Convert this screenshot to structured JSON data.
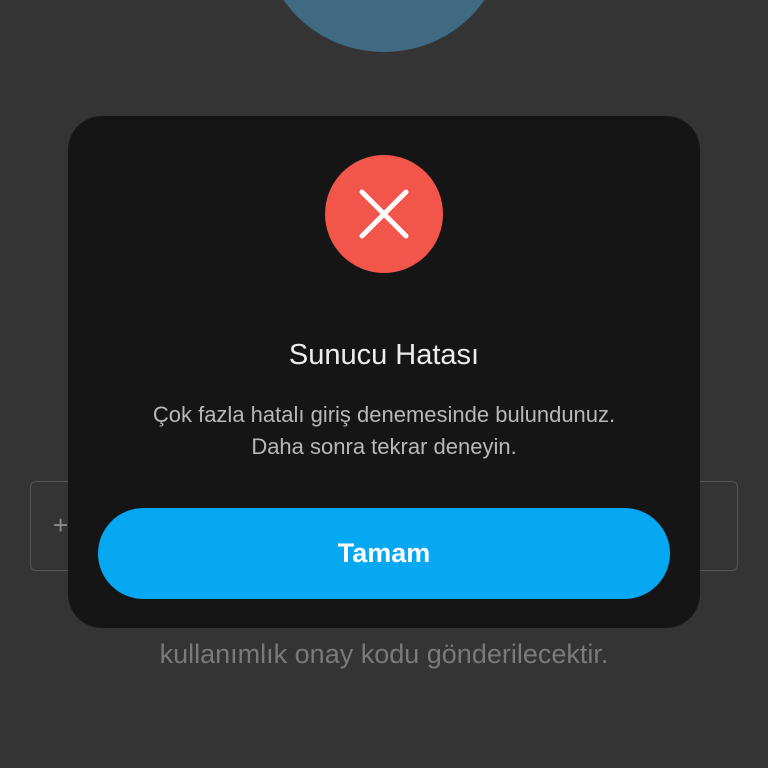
{
  "background": {
    "phone_prefix": "+",
    "info_line_1": "kullanımlık onay kodu gönderilecektir.",
    "info_line_2": ""
  },
  "dialog": {
    "icon": "error-x-icon",
    "title": "Sunucu Hatası",
    "message_line_1": "Çok fazla hatalı giriş denemesinde bulundunuz.",
    "message_line_2": "Daha sonra tekrar deneyin.",
    "ok_label": "Tamam"
  },
  "colors": {
    "backdrop": "#343434",
    "dialog_bg": "#151515",
    "error_red": "#f2554a",
    "button_blue": "#06a8f2",
    "avatar_blue": "#3f6a82"
  }
}
